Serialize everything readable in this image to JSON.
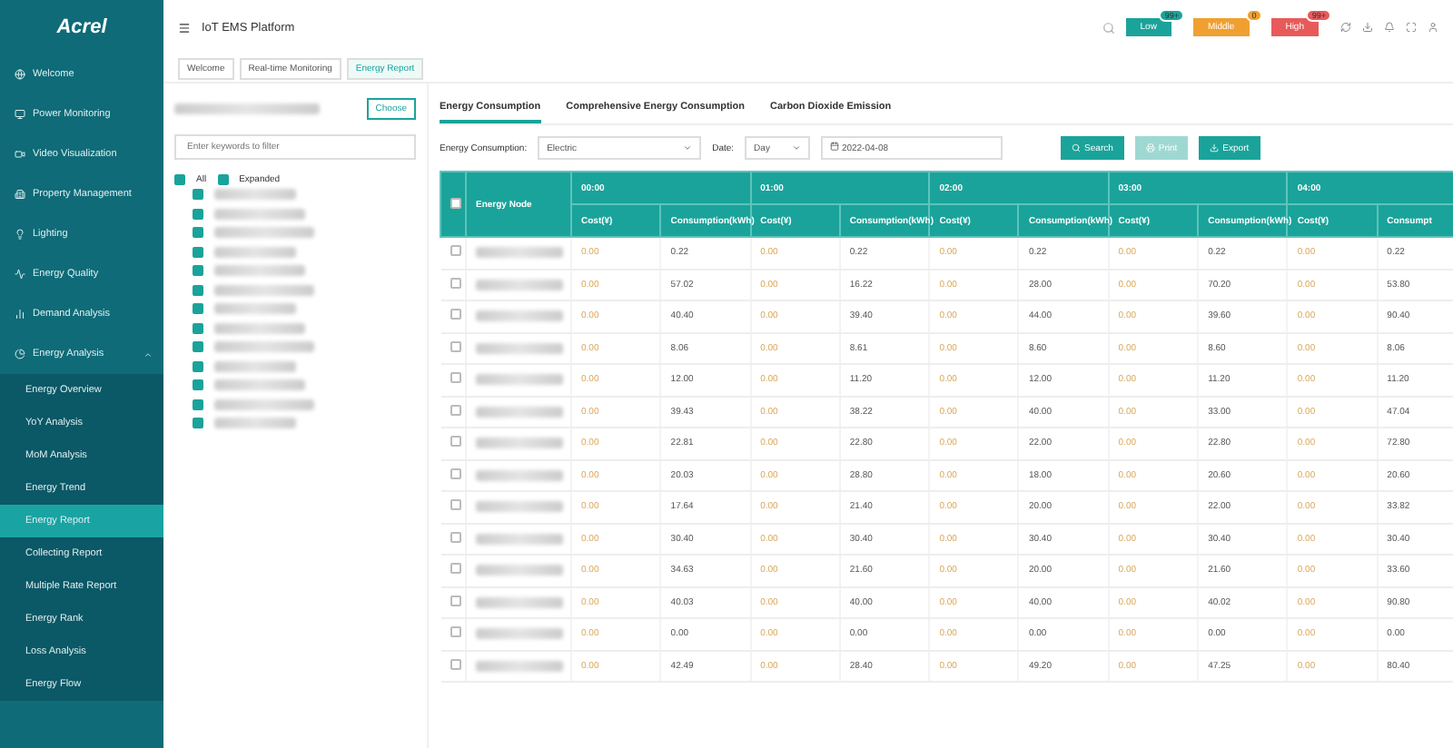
{
  "logo": "Acrel",
  "header": {
    "title": "IoT EMS Platform",
    "alarms": [
      {
        "label": "Low",
        "count": "99+",
        "color": "#1aa39a"
      },
      {
        "label": "Middle",
        "count": "0",
        "color": "#f0a030"
      },
      {
        "label": "High",
        "count": "99+",
        "color": "#e85a5a"
      }
    ]
  },
  "sidebar": {
    "items": [
      {
        "label": "Welcome",
        "selected": false
      },
      {
        "label": "Power Monitoring",
        "selected": false
      },
      {
        "label": "Video Visualization",
        "selected": false
      },
      {
        "label": "Property Management",
        "selected": false
      },
      {
        "label": "Lighting",
        "selected": false
      },
      {
        "label": "Energy Quality",
        "selected": false
      },
      {
        "label": "Demand Analysis",
        "selected": false
      },
      {
        "label": "Energy Analysis",
        "selected": false,
        "expanded": true,
        "children": [
          {
            "label": "Energy Overview",
            "selected": false
          },
          {
            "label": "YoY Analysis",
            "selected": false
          },
          {
            "label": "MoM Analysis",
            "selected": false
          },
          {
            "label": "Energy Trend",
            "selected": false
          },
          {
            "label": "Energy Report",
            "selected": true
          },
          {
            "label": "Collecting Report",
            "selected": false
          },
          {
            "label": "Multiple Rate Report",
            "selected": false
          },
          {
            "label": "Energy Rank",
            "selected": false
          },
          {
            "label": "Loss Analysis",
            "selected": false
          },
          {
            "label": "Energy Flow",
            "selected": false
          }
        ]
      }
    ]
  },
  "breadcrumbs": [
    {
      "label": "Welcome",
      "selected": false
    },
    {
      "label": "Real-time Monitoring",
      "selected": false
    },
    {
      "label": "Energy Report",
      "selected": true
    }
  ],
  "left_panel": {
    "choose_button": "Choose",
    "search": {
      "placeholder": "Enter keywords to filter"
    },
    "all": {
      "label": "All",
      "checked": true
    },
    "expanded": {
      "label": "Expanded",
      "checked": true
    },
    "tree": [
      {
        "checked": true
      },
      {
        "checked": true
      },
      {
        "checked": true
      },
      {
        "checked": true
      },
      {
        "checked": true
      },
      {
        "checked": true
      },
      {
        "checked": true
      },
      {
        "checked": true
      },
      {
        "checked": true
      },
      {
        "checked": true
      },
      {
        "checked": true
      },
      {
        "checked": true
      },
      {
        "checked": true
      }
    ]
  },
  "tabs": [
    {
      "label": "Energy Consumption",
      "selected": true
    },
    {
      "label": "Comprehensive Energy Consumption",
      "selected": false
    },
    {
      "label": "Carbon Dioxide Emission",
      "selected": false
    }
  ],
  "filters": {
    "type_label": "Energy Consumption:",
    "type_value": "Electric",
    "date_label": "Date:",
    "date_unit": "Day",
    "date_value": "2022-04-08"
  },
  "buttons": [
    {
      "label": "Search",
      "disabled": false
    },
    {
      "label": "Print",
      "disabled": true
    },
    {
      "label": "Export",
      "disabled": false
    }
  ],
  "table": {
    "select_all": {
      "checked": false
    },
    "row_checks": [
      {
        "checked": false
      },
      {
        "checked": false
      },
      {
        "checked": false
      },
      {
        "checked": false
      },
      {
        "checked": false
      },
      {
        "checked": false
      },
      {
        "checked": false
      },
      {
        "checked": false
      },
      {
        "checked": false
      },
      {
        "checked": false
      },
      {
        "checked": false
      },
      {
        "checked": false
      },
      {
        "checked": false
      },
      {
        "checked": false
      }
    ],
    "node_header": "Energy Node",
    "groups": [
      {
        "time": "00:00",
        "cost": "Cost(¥)",
        "consumption": "Consumption(kWh)"
      },
      {
        "time": "01:00",
        "cost": "Cost(¥)",
        "consumption": "Consumption(kWh)"
      },
      {
        "time": "02:00",
        "cost": "Cost(¥)",
        "consumption": "Consumption(kWh)"
      },
      {
        "time": "03:00",
        "cost": "Cost(¥)",
        "consumption": "Consumption(kWh)"
      },
      {
        "time": "04:00",
        "cost": "Cost(¥)",
        "consumption": "Consumpt"
      }
    ],
    "rows": [
      [
        "0.00",
        "0.22",
        "0.00",
        "0.22",
        "0.00",
        "0.22",
        "0.00",
        "0.22",
        "0.00",
        "0.22"
      ],
      [
        "0.00",
        "57.02",
        "0.00",
        "16.22",
        "0.00",
        "28.00",
        "0.00",
        "70.20",
        "0.00",
        "53.80"
      ],
      [
        "0.00",
        "40.40",
        "0.00",
        "39.40",
        "0.00",
        "44.00",
        "0.00",
        "39.60",
        "0.00",
        "90.40"
      ],
      [
        "0.00",
        "8.06",
        "0.00",
        "8.61",
        "0.00",
        "8.60",
        "0.00",
        "8.60",
        "0.00",
        "8.06"
      ],
      [
        "0.00",
        "12.00",
        "0.00",
        "11.20",
        "0.00",
        "12.00",
        "0.00",
        "11.20",
        "0.00",
        "11.20"
      ],
      [
        "0.00",
        "39.43",
        "0.00",
        "38.22",
        "0.00",
        "40.00",
        "0.00",
        "33.00",
        "0.00",
        "47.04"
      ],
      [
        "0.00",
        "22.81",
        "0.00",
        "22.80",
        "0.00",
        "22.00",
        "0.00",
        "22.80",
        "0.00",
        "72.80"
      ],
      [
        "0.00",
        "20.03",
        "0.00",
        "28.80",
        "0.00",
        "18.00",
        "0.00",
        "20.60",
        "0.00",
        "20.60"
      ],
      [
        "0.00",
        "17.64",
        "0.00",
        "21.40",
        "0.00",
        "20.00",
        "0.00",
        "22.00",
        "0.00",
        "33.82"
      ],
      [
        "0.00",
        "30.40",
        "0.00",
        "30.40",
        "0.00",
        "30.40",
        "0.00",
        "30.40",
        "0.00",
        "30.40"
      ],
      [
        "0.00",
        "34.63",
        "0.00",
        "21.60",
        "0.00",
        "20.00",
        "0.00",
        "21.60",
        "0.00",
        "33.60"
      ],
      [
        "0.00",
        "40.03",
        "0.00",
        "40.00",
        "0.00",
        "40.00",
        "0.00",
        "40.02",
        "0.00",
        "90.80"
      ],
      [
        "0.00",
        "0.00",
        "0.00",
        "0.00",
        "0.00",
        "0.00",
        "0.00",
        "0.00",
        "0.00",
        "0.00"
      ],
      [
        "0.00",
        "42.49",
        "0.00",
        "28.40",
        "0.00",
        "49.20",
        "0.00",
        "47.25",
        "0.00",
        "80.40"
      ]
    ]
  }
}
